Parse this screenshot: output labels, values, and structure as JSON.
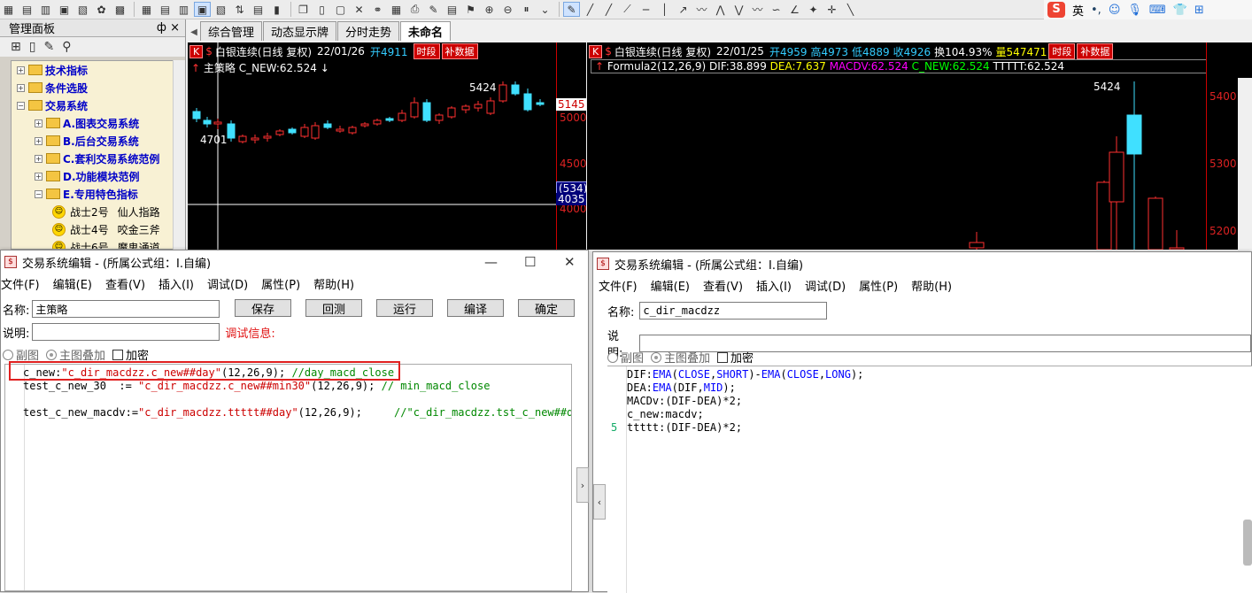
{
  "ime": {
    "lang": "英",
    "punct": "•,"
  },
  "left_panel": {
    "title": "管理面板",
    "pin": "ф ×",
    "tree": [
      {
        "label": "技术指标",
        "level": 0,
        "type": "folder",
        "expanded": false
      },
      {
        "label": "条件选股",
        "level": 0,
        "type": "folder",
        "expanded": false
      },
      {
        "label": "交易系统",
        "level": 0,
        "type": "folder",
        "expanded": true
      },
      {
        "label": "A.图表交易系统",
        "level": 1,
        "type": "folder",
        "expanded": false
      },
      {
        "label": "B.后台交易系统",
        "level": 1,
        "type": "folder",
        "expanded": false
      },
      {
        "label": "C.套利交易系统范例",
        "level": 1,
        "type": "folder",
        "expanded": false
      },
      {
        "label": "D.功能模块范例",
        "level": 1,
        "type": "folder",
        "expanded": false
      },
      {
        "label": "E.专用特色指标",
        "level": 1,
        "type": "folder",
        "expanded": true
      },
      {
        "label": "战士2号",
        "desc": "仙人指路",
        "level": 2,
        "type": "item"
      },
      {
        "label": "战士4号",
        "desc": "咬金三斧",
        "level": 2,
        "type": "item"
      },
      {
        "label": "战士6号",
        "desc": "魔鬼通道",
        "level": 2,
        "type": "item"
      }
    ]
  },
  "tabs": [
    {
      "label": "综合管理",
      "active": false
    },
    {
      "label": "动态显示牌",
      "active": false
    },
    {
      "label": "分时走势",
      "active": false
    },
    {
      "label": "未命名",
      "active": true
    }
  ],
  "chart1": {
    "header": {
      "symbol": "白银连续(日线 复权)",
      "date": "22/01/26",
      "open": "开4911",
      "btn1": "时段",
      "btn2": "补数据"
    },
    "legend": {
      "name": "主策略",
      "var": "C_NEW:62.524"
    },
    "labels": {
      "high": "5424",
      "low": "4701",
      "price_tag": "5145",
      "vol_tag": "(534)",
      "cross_price": "4035"
    },
    "ticks": [
      "5000",
      "4500",
      "4000"
    ]
  },
  "chart2": {
    "header": {
      "symbol": "白银连续(日线 复权)",
      "date": "22/01/25",
      "open": "开4959",
      "high": "高4973",
      "low": "低4889",
      "close": "收4926",
      "turnover": "换104.93%",
      "vol": "量547471",
      "btn1": "时段",
      "btn2": "补数据"
    },
    "legend": {
      "formula": "Formula2(12,26,9)",
      "dif": "DIF:38.899",
      "dea": "DEA:7.637",
      "macdv": "MACDV:62.524",
      "cnew": "C_NEW:62.524",
      "ttttt": "TTTTT:62.524"
    },
    "labels": {
      "high": "5424"
    },
    "ticks": [
      "5400",
      "5300",
      "5200"
    ]
  },
  "win1": {
    "title": "交易系统编辑 - (所属公式组：I.自编)",
    "menu": [
      "文件(F)",
      "编辑(E)",
      "查看(V)",
      "插入(I)",
      "调试(D)",
      "属性(P)",
      "帮助(H)"
    ],
    "name_label": "名称:",
    "name_value": "主策略",
    "desc_label": "说明:",
    "desc_value": "",
    "debug_label": "调试信息:",
    "buttons": [
      "保存",
      "回测",
      "运行",
      "编译",
      "确定"
    ],
    "opt_sub": "副图",
    "opt_main": "主图叠加",
    "opt_encrypt": "加密",
    "code": [
      {
        "a": "c_new:",
        "b": "\"c_dir_macdzz.c_new##day\"",
        "c": "(12,26,9);",
        "d": " //day_macd_close"
      },
      {
        "a": "test_c_new_30  :=",
        "b": " \"c_dir_macdzz.c_new##min30\"",
        "c": "(12,26,9);",
        "d": " // min_macd_close"
      },
      {
        "a": "",
        "b": "",
        "c": "",
        "d": ""
      },
      {
        "a": "test_c_new_macdv:=",
        "b": "\"c_dir_macdzz.ttttt##day\"",
        "c": "(12,26,9);",
        "d": "     //\"c_dir_macdzz.tst_c_new##day\""
      }
    ]
  },
  "win2": {
    "title": "交易系统编辑 - (所属公式组：I.自编)",
    "menu": [
      "文件(F)",
      "编辑(E)",
      "查看(V)",
      "插入(I)",
      "调试(D)",
      "属性(P)",
      "帮助(H)"
    ],
    "name_label": "名称:",
    "name_value": "c_dir_macdzz",
    "desc_label": "说明:",
    "desc_value": "",
    "opt_sub": "副图",
    "opt_main": "主图叠加",
    "opt_encrypt": "加密",
    "gutter_mark": "5",
    "code": [
      "DIF:EMA(CLOSE,SHORT)-EMA(CLOSE,LONG);",
      "DEA:EMA(DIF,MID);",
      "MACDv:(DIF-DEA)*2;",
      "c_new:macdv;",
      "ttttt:(DIF-DEA)*2;"
    ]
  }
}
